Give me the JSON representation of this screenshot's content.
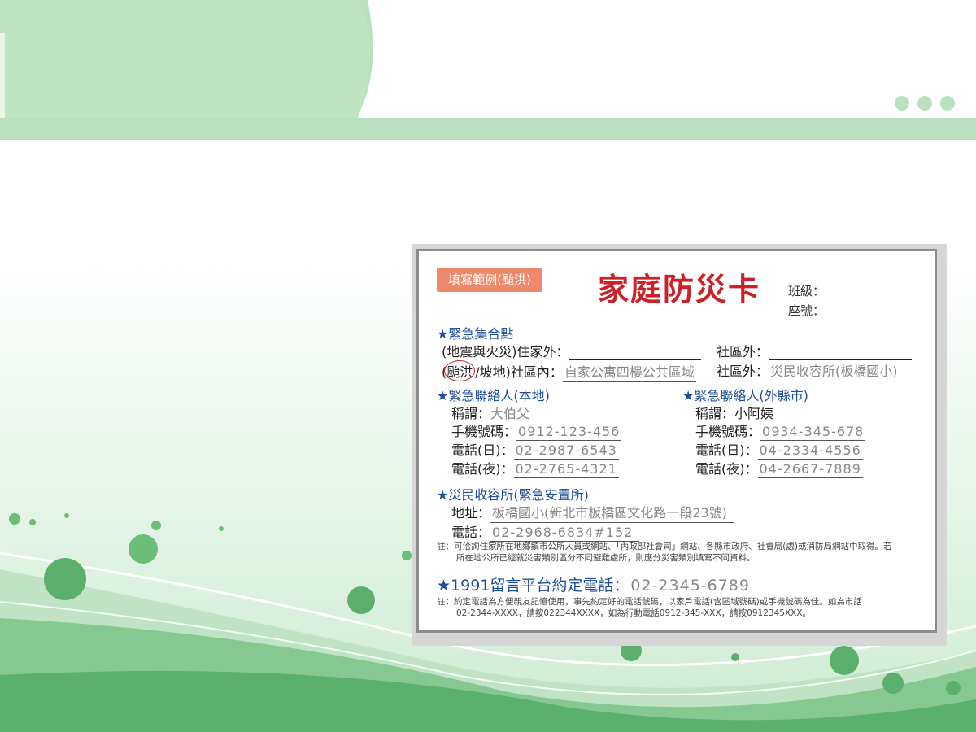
{
  "colors": {
    "green_band": "#b8e0be",
    "green_light": "#d6eed8",
    "green_mid": "#8fcf98",
    "green_dark": "#5cb16c",
    "title_red": "#cc2128",
    "section_blue": "#1f4f9a",
    "badge_orange": "#ee8a6c"
  },
  "card": {
    "badge": "填寫範例(颱洪)",
    "title": "家庭防災卡",
    "class_label": "班級：",
    "seat_label": "座號：",
    "assembly": {
      "heading": "★緊急集合點",
      "row1_prefix": "(地震與火災)住家外：",
      "row1_outside_label": "社區外：",
      "row2_circled": "颱洪",
      "row2_prefix": "/坡地)社區內：",
      "row2_inside_value": "自家公寓四樓公共區域",
      "row2_outside_label": "社區外：",
      "row2_outside_value": "災民收容所(板橋國小)"
    },
    "contact_local": {
      "heading": "★緊急聯絡人(本地)",
      "name_label": "稱謂：",
      "name_value": "大伯父",
      "mobile_label": "手機號碼：",
      "mobile_value": "0912-123-456",
      "day_label": "電話(日)：",
      "day_value": "02-2987-6543",
      "night_label": "電話(夜)：",
      "night_value": "02-2765-4321"
    },
    "contact_remote": {
      "heading": "★緊急聯絡人(外縣市)",
      "name_label": "稱謂：",
      "name_value": "小阿姨",
      "mobile_label": "手機號碼：",
      "mobile_value": "0934-345-678",
      "day_label": "電話(日)：",
      "day_value": "04-2334-4556",
      "night_label": "電話(夜)：",
      "night_value": "04-2667-7889"
    },
    "shelter": {
      "heading": "★災民收容所(緊急安置所)",
      "address_label": "地址：",
      "address_value": "板橋國小(新北市板橋區文化路一段23號)",
      "phone_label": "電話：",
      "phone_value": "02-2968-6834#152"
    },
    "note1_line1": "註：可洽詢住家所在地鄉鎮市公所人員或網站、「內政部社會司」網站、各縣市政府、社會局(處)或消防局網站中取得。若",
    "note1_line2": "所在地公所已經就災害類別區分不同避難處所，則應分災害類別填寫不同資料。",
    "message_line": {
      "label": "★1991留言平台約定電話：",
      "value": "02-2345-6789"
    },
    "note2_line1": "註：約定電話為方便親友記憶使用，事先約定好的電話號碼，以家戶電話(含區域號碼)或手機號碼為佳。如為市話",
    "note2_line2": "02-2344-XXXX，請按022344XXXX，如為行動電話0912-345-XXX，請按0912345XXX。"
  }
}
